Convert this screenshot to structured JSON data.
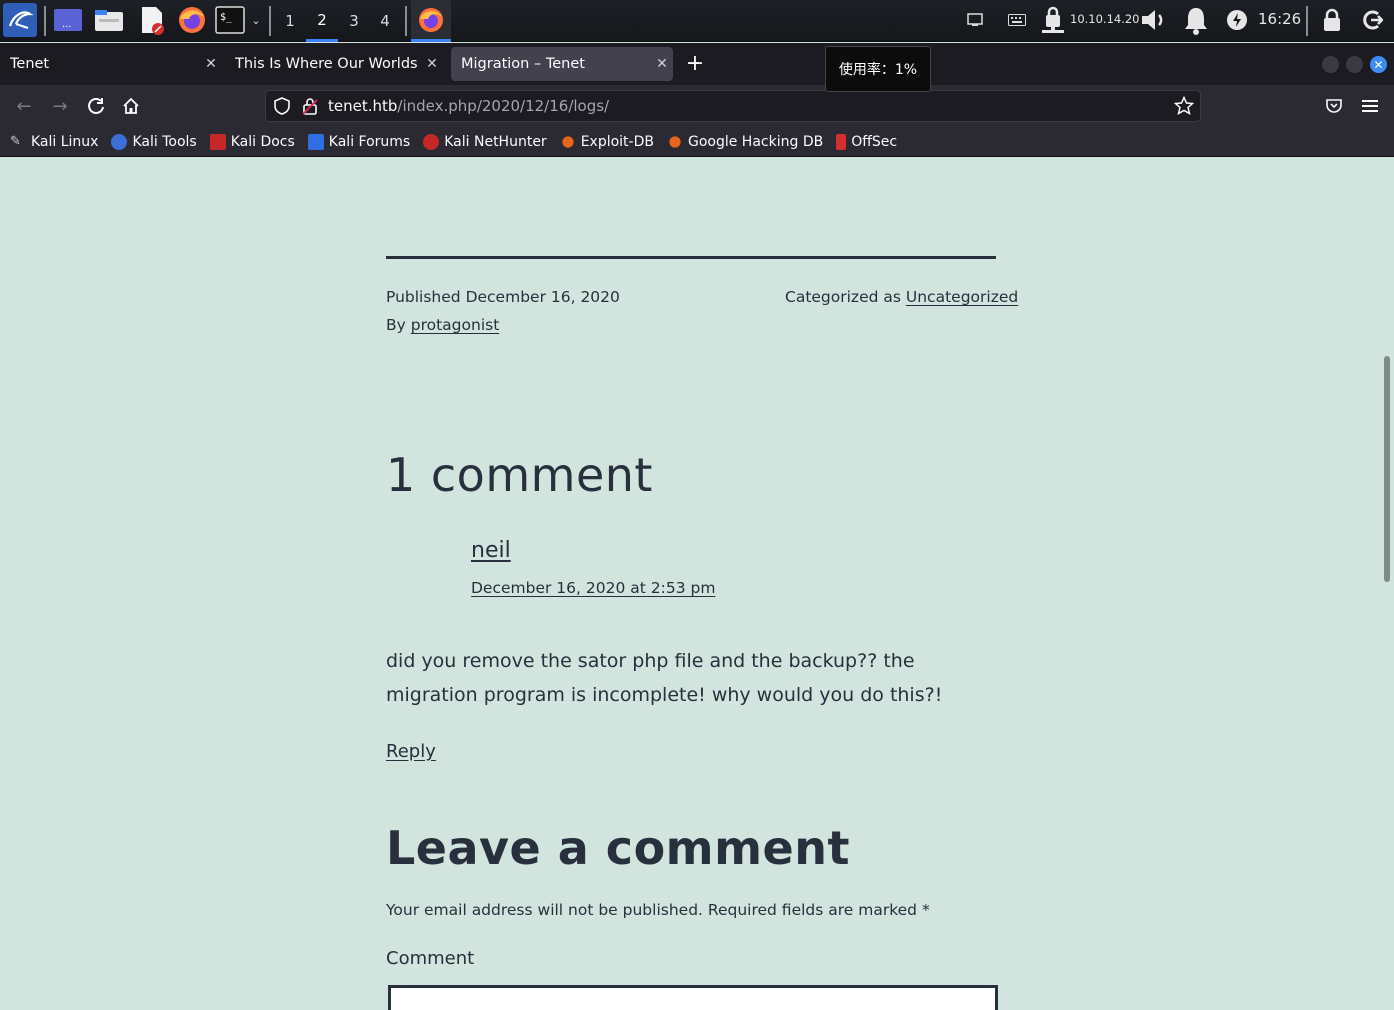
{
  "panel": {
    "workspaces": [
      "1",
      "2",
      "3",
      "4"
    ],
    "active_workspace": "2",
    "ip": "10.10.14.20",
    "clock": "16:26"
  },
  "tabs": [
    {
      "title": "Tenet",
      "active": false
    },
    {
      "title": "This Is Where Our Worlds Co",
      "active": false
    },
    {
      "title": "Migration – Tenet",
      "active": true
    }
  ],
  "tooltip": "使用率：1%",
  "urlbar": {
    "host": "tenet.htb",
    "path": "/index.php/2020/12/16/logs/"
  },
  "bookmarks": [
    {
      "label": "Kali Linux",
      "color": "#444"
    },
    {
      "label": "Kali Tools",
      "color": "#3b6fd6"
    },
    {
      "label": "Kali Docs",
      "color": "#c62828"
    },
    {
      "label": "Kali Forums",
      "color": "#2f6fe0"
    },
    {
      "label": "Kali NetHunter",
      "color": "#c62828"
    },
    {
      "label": "Exploit-DB",
      "color": "#e8641b"
    },
    {
      "label": "Google Hacking DB",
      "color": "#e8641b"
    },
    {
      "label": "OffSec",
      "color": "#d32f2f"
    }
  ],
  "post": {
    "published_label": "Published",
    "published_date": "December 16, 2020",
    "by_label": "By",
    "author": "protagonist",
    "categorized_label": "Categorized as",
    "category": "Uncategorized"
  },
  "comments": {
    "title": "1 comment",
    "items": [
      {
        "author": "neil",
        "date": "December 16, 2020 at 2:53 pm",
        "body": "did you remove the sator php file and the backup?? the migration program is incomplete! why would you do this?!",
        "reply_label": "Reply"
      }
    ]
  },
  "form": {
    "title": "Leave a comment",
    "notice": "Your email address will not be published. Required fields are marked *",
    "comment_label": "Comment"
  }
}
